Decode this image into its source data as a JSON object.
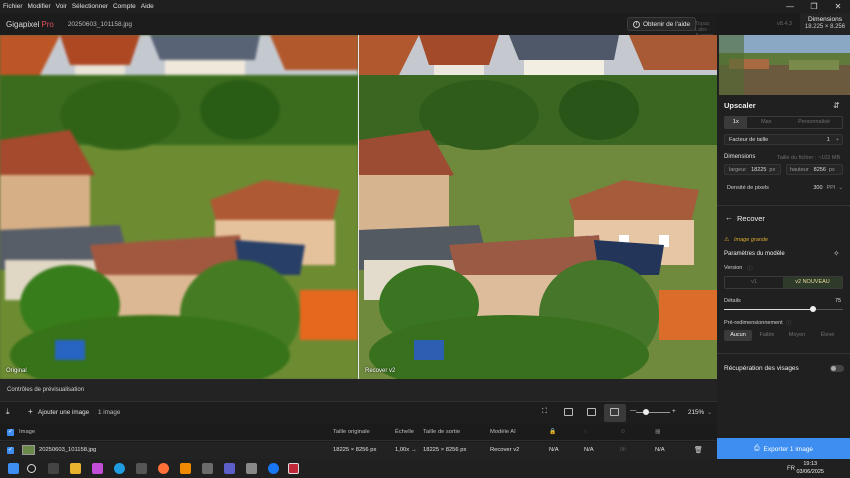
{
  "menu": [
    "Fichier",
    "Modifier",
    "Voir",
    "Sélectionner",
    "Compte",
    "Aide"
  ],
  "window_controls": [
    "—",
    "❐",
    "✕"
  ],
  "app": {
    "name": "Gigapixel",
    "edition": "Pro",
    "filename": "20250603_101158.jpg"
  },
  "header": {
    "help_label": "Obtenir de l'aide",
    "model_hint": "Topaz Labs · Avance Rotante",
    "version": "v8.4.3",
    "dimensions_title": "Dimensions",
    "dimensions_value": "18.225 × 8.256"
  },
  "preview": {
    "left_label": "Original",
    "right_label": "Recover v2"
  },
  "panel": {
    "upscaler_title": "Upscaler",
    "scale_options": [
      "1x",
      "Max",
      "Personnalisé"
    ],
    "scale_active": "1x",
    "factor_label": "Facteur de taille",
    "factor_value": "1",
    "dimensions_label": "Dimensions",
    "file_size_hint": "Taille du fichier : ~102 MB",
    "width_label": "largeur",
    "width_value": "18225",
    "width_unit": "px",
    "height_label": "hauteur",
    "height_value": "8256",
    "height_unit": "px",
    "density_label": "Densité de pixels",
    "density_value": "300",
    "density_unit": "PPI",
    "recover_title": "Recover",
    "recover_note": "Image grande",
    "model_params_label": "Paramètres du modèle",
    "version_label": "Version",
    "version_options": [
      "v1",
      "v2 NOUVEAU"
    ],
    "version_active": "v2 NOUVEAU",
    "details_label": "Détails",
    "details_value": "75",
    "details_level": 0.75,
    "presizing_label": "Pré-redimensionnement",
    "presizing_options": [
      "Aucun",
      "Faible",
      "Moyen",
      "Élevé"
    ],
    "presizing_active": "Aucun",
    "face_recovery_label": "Récupération des visages"
  },
  "export_label": "Exporter 1 image",
  "bottom": {
    "controls_label": "Contrôles de prévisualisation",
    "add_image_label": "Ajouter une image",
    "image_count": "1 image",
    "zoom_value": "215%",
    "columns": [
      "Image",
      "Taille originale",
      "Échelle",
      "Taille de sortie",
      "Modèle AI"
    ],
    "row": {
      "name": "20250603_101158.jpg",
      "original_size": "18225 × 8256 px",
      "scale": "1,00x",
      "arrow": "→",
      "output_size": "18225 × 8256 px",
      "model": "Recover v2",
      "col_a": "N/A",
      "col_b": "N/A",
      "col_c": "Ilfi",
      "col_d": "N/A"
    }
  },
  "taskbar": {
    "lang": "FR",
    "time": "19:13",
    "date": "03/06/2025"
  },
  "colors": {
    "accent": "#3d8ef0",
    "brand_pro": "#e04f5a",
    "recover_note": "#d9a92b"
  }
}
